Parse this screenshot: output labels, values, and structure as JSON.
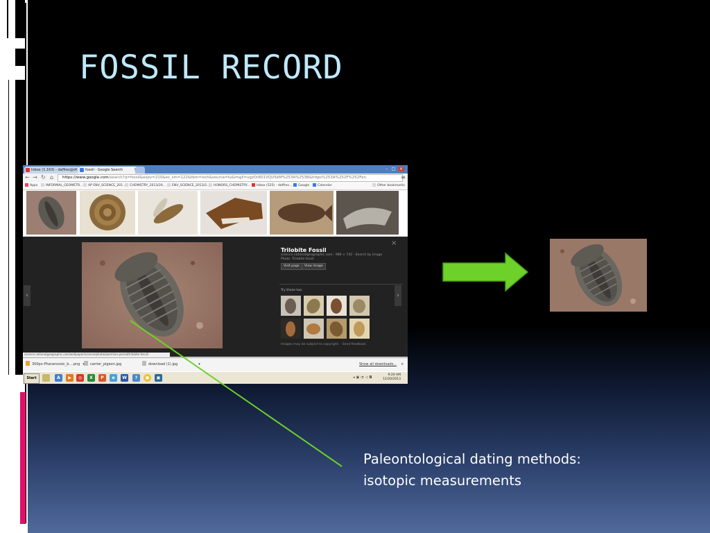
{
  "slide": {
    "title": "FOSSIL RECORD",
    "caption_line1": "Paleontological dating methods:",
    "caption_line2": "isotopic measurements"
  },
  "browser": {
    "tabs": [
      {
        "label": "Inbox (1,163) - daffres@c",
        "icon": "gmail-icon"
      },
      {
        "label": "fossil - Google Search",
        "icon": "google-icon"
      }
    ],
    "address_host": "https://www.google.com",
    "address_path": "/search?q=fossil&espv=210&es_sm=122&tbm=isch&source=lu&imgil=vgzOrR01VQU5kM%253A%253B&https%253A%252F%252Fen",
    "bookmarks": [
      "Apps",
      "INFORMAL_GEOMETR...",
      "AP ENV_SCIENCE_201...",
      "CHEMISTRY_2013/20...",
      "ENV_SCIENCE_2013/2...",
      "HONORS_CHEMISTRY...",
      "Inbox (525) - daffres...",
      "Google",
      "Calendar",
      "Other bookmarks"
    ],
    "result_thumbnails": [
      "trilobite",
      "ammonite",
      "insect-in-amber",
      "t-rex-skull",
      "fish-fossil",
      "dinosaur-skeleton"
    ],
    "panel": {
      "title": "Trilobite Fossil",
      "meta": "science.nationalgeographic.com · 989 × 742 · Search by image",
      "photo_label": "Photo: Trilobite fossil",
      "visit_page": "Visit page",
      "view_image": "View image",
      "try_these": "Try these too:",
      "related": [
        "trilobite",
        "trilobite",
        "trilobite",
        "trilobite",
        "trilobite",
        "trilobite",
        "trilobite",
        "trilobite"
      ],
      "credit": "Images may be subject to copyright. · Send feedback"
    },
    "status_url": "science.nationalgeographic.com/wallpaper/science/photos/permian-period/trilobite-fossil/",
    "downloads": [
      "300px-Phanerozoic_b....png",
      "carrier_pigeon.jpg",
      "download (1).jpg"
    ],
    "show_all_downloads": "Show all downloads...",
    "taskbar": {
      "start_label": "Start",
      "time": "9:20 AM",
      "date": "12/20/2013"
    }
  },
  "colors": {
    "title": "#bfe9fb",
    "arrow": "#6dd12a",
    "connector_line": "#6dd12a",
    "accent_bar": "#e0106a"
  }
}
